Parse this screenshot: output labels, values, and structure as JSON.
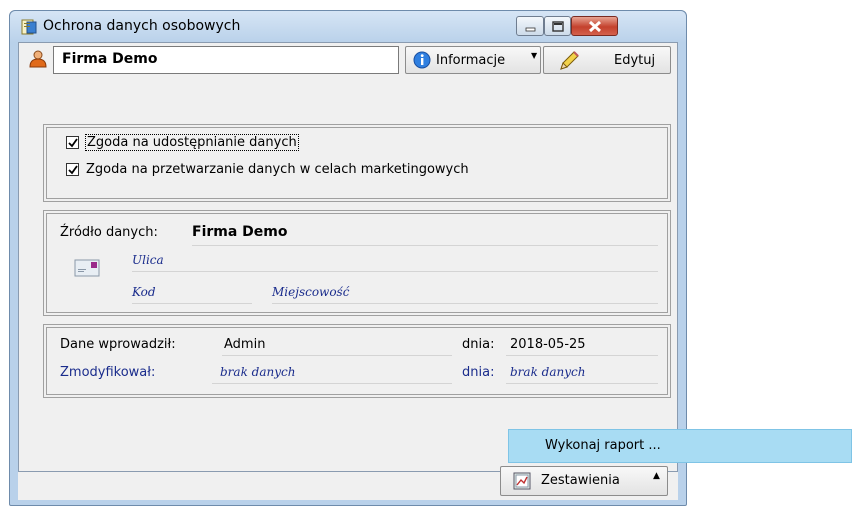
{
  "window": {
    "title": "Ochrona danych osobowych",
    "icon": "app-document-icon"
  },
  "toolbar": {
    "entity_name": "Firma Demo",
    "info_button": "Informacje",
    "edit_button": "Edytuj"
  },
  "consents": [
    {
      "label": "Zgoda na udostępnianie danych",
      "checked": true
    },
    {
      "label": "Zgoda na przetwarzanie danych w celach marketingowych",
      "checked": true
    }
  ],
  "source": {
    "label": "Źródło danych:",
    "value": "Firma Demo",
    "street_placeholder": "Ulica",
    "postcode_placeholder": "Kod",
    "city_placeholder": "Miejscowość"
  },
  "audit": {
    "entered_label": "Dane wprowadził:",
    "entered_by": "Admin",
    "entered_date_label": "dnia:",
    "entered_date": "2018-05-25",
    "modified_label": "Zmodyfikował:",
    "modified_by": "brak danych",
    "modified_date_label": "dnia:",
    "modified_date": "brak danych"
  },
  "menu": {
    "item": "Wykonaj raport ..."
  },
  "reports_button": "Zestawienia",
  "colors": {
    "menu_highlight": "#a8dcf3",
    "link_blue": "#1a2c8c",
    "close_red": "#c4412d"
  }
}
